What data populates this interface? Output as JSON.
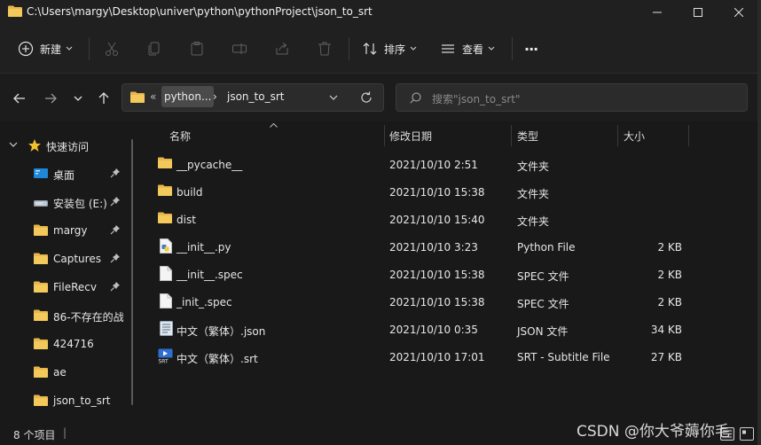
{
  "window": {
    "title": "C:\\Users\\margy\\Desktop\\univer\\python\\pythonProject\\json_to_srt",
    "minimize_icon": "minimize-icon",
    "maximize_icon": "maximize-icon",
    "close_icon": "close-icon"
  },
  "toolbar": {
    "new_label": "新建",
    "sort_label": "排序",
    "view_label": "查看",
    "more_label": "···"
  },
  "address": {
    "overflow": "«",
    "crumb_parent": "python...",
    "separator": "›",
    "crumb_current": "json_to_srt"
  },
  "search": {
    "placeholder": "搜索\"json_to_srt\""
  },
  "sidebar": {
    "quick_access": "快速访问",
    "items": [
      {
        "label": "桌面",
        "icon": "desktop-icon",
        "pinned": true
      },
      {
        "label": "安装包 (E:)",
        "icon": "drive-icon",
        "pinned": true
      },
      {
        "label": "margy",
        "icon": "folder-icon",
        "pinned": true
      },
      {
        "label": "Captures",
        "icon": "folder-icon",
        "pinned": true
      },
      {
        "label": "FileRecv",
        "icon": "folder-icon",
        "pinned": true
      },
      {
        "label": "86-不存在的战",
        "icon": "folder-icon",
        "pinned": false
      },
      {
        "label": "424716",
        "icon": "folder-icon",
        "pinned": false
      },
      {
        "label": "ae",
        "icon": "folder-icon",
        "pinned": false
      },
      {
        "label": "json_to_srt",
        "icon": "folder-icon",
        "pinned": false
      }
    ]
  },
  "columns": {
    "name": "名称",
    "modified": "修改日期",
    "type": "类型",
    "size": "大小"
  },
  "files": [
    {
      "name": "__pycache__",
      "modified": "2021/10/10 2:51",
      "type": "文件夹",
      "size": "",
      "icon": "folder-icon"
    },
    {
      "name": "build",
      "modified": "2021/10/10 15:38",
      "type": "文件夹",
      "size": "",
      "icon": "folder-icon"
    },
    {
      "name": "dist",
      "modified": "2021/10/10 15:40",
      "type": "文件夹",
      "size": "",
      "icon": "folder-icon"
    },
    {
      "name": "__init__.py",
      "modified": "2021/10/10 3:23",
      "type": "Python File",
      "size": "2 KB",
      "icon": "python-file-icon"
    },
    {
      "name": "__init__.spec",
      "modified": "2021/10/10 15:38",
      "type": "SPEC 文件",
      "size": "2 KB",
      "icon": "file-icon"
    },
    {
      "name": "_init_.spec",
      "modified": "2021/10/10 15:38",
      "type": "SPEC 文件",
      "size": "2 KB",
      "icon": "file-icon"
    },
    {
      "name": "中文（繁体）.json",
      "modified": "2021/10/10 0:35",
      "type": "JSON 文件",
      "size": "34 KB",
      "icon": "json-file-icon"
    },
    {
      "name": "中文（繁体）.srt",
      "modified": "2021/10/10 17:01",
      "type": "SRT - Subtitle File",
      "size": "27 KB",
      "icon": "srt-file-icon"
    }
  ],
  "status": {
    "item_count": "8 个项目",
    "divider": "|"
  },
  "watermark": "CSDN @你大爷薅你毛",
  "colors": {
    "folder": "#e8b64c",
    "accent": "#4cc2ff"
  }
}
